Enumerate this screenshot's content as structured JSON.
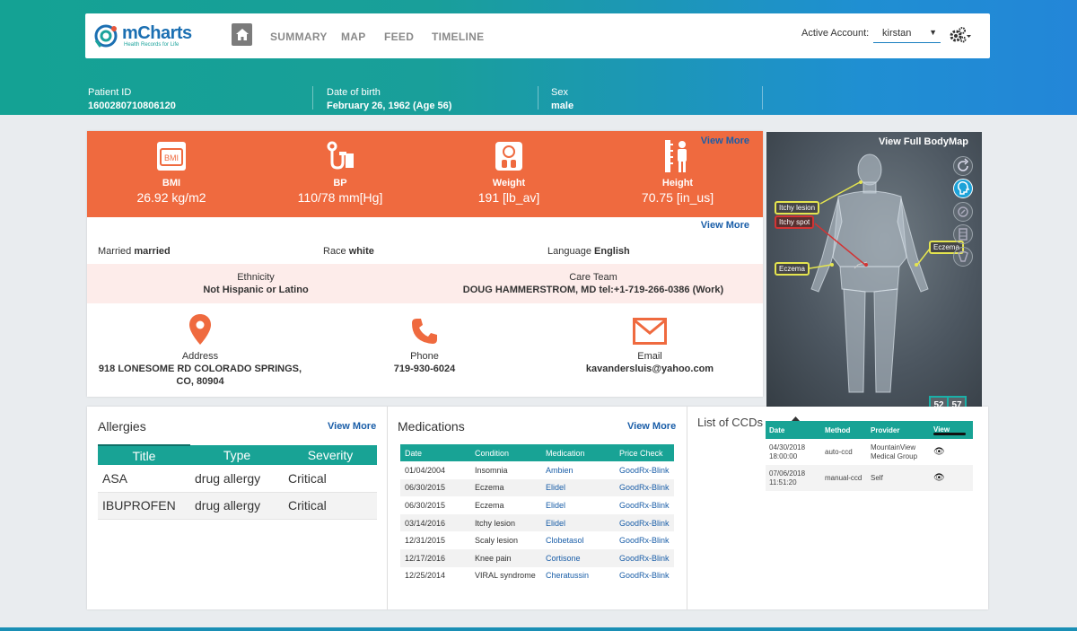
{
  "nav": {
    "logo_name": "mCharts",
    "logo_tagline": "Health Records for Life",
    "links": [
      "SUMMARY",
      "MAP",
      "FEED",
      "TIMELINE"
    ],
    "active_account_label": "Active Account:",
    "active_account_value": "kirstan"
  },
  "patient": {
    "id_label": "Patient ID",
    "id_value": "1600280710806120",
    "dob_label": "Date of birth",
    "dob_value": "February 26, 1962 (Age 56)",
    "sex_label": "Sex",
    "sex_value": "male"
  },
  "vitals": {
    "view_more": "View More",
    "items": [
      {
        "name": "BMI",
        "value": "26.92 kg/m2",
        "icon": "bmi-scale-icon"
      },
      {
        "name": "BP",
        "value": "110/78 mm[Hg]",
        "icon": "stethoscope-icon"
      },
      {
        "name": "Weight",
        "value": "191 [lb_av]",
        "icon": "weight-scale-icon"
      },
      {
        "name": "Height",
        "value": "70.75 [in_us]",
        "icon": "height-ruler-icon"
      }
    ]
  },
  "demographics": {
    "view_more": "View More",
    "married_label": "Married",
    "married_value": "married",
    "race_label": "Race",
    "race_value": "white",
    "language_label": "Language",
    "language_value": "English",
    "ethnicity_label": "Ethnicity",
    "ethnicity_value": "Not Hispanic or Latino",
    "careteam_label": "Care Team",
    "careteam_value": "DOUG HAMMERSTROM, MD tel:+1-719-266-0386 (Work)"
  },
  "contact": {
    "address_label": "Address",
    "address_line1": "918 LONESOME RD COLORADO SPRINGS,",
    "address_line2": "CO, 80904",
    "phone_label": "Phone",
    "phone_value": "719-930-6024",
    "email_label": "Email",
    "email_value": "kavandersluis@yahoo.com"
  },
  "bodymap": {
    "title": "View Full BodyMap",
    "lesions": [
      "Itchy lesion",
      "Itchy spot",
      "Eczema",
      "Eczema"
    ],
    "counters": [
      "52",
      "57"
    ]
  },
  "allergies": {
    "title": "Allergies",
    "view_more": "View More",
    "columns": [
      "Title",
      "Type",
      "Severity"
    ],
    "rows": [
      [
        "ASA",
        "drug allergy",
        "Critical"
      ],
      [
        "IBUPROFEN",
        "drug allergy",
        "Critical"
      ]
    ]
  },
  "medications": {
    "title": "Medications",
    "view_more": "View More",
    "columns": [
      "Date",
      "Condition",
      "Medication",
      "Price Check"
    ],
    "rows": [
      [
        "01/04/2004",
        "Insomnia",
        "Ambien",
        "GoodRx-Blink"
      ],
      [
        "06/30/2015",
        "Eczema",
        "Elidel",
        "GoodRx-Blink"
      ],
      [
        "06/30/2015",
        "Eczema",
        "Elidel",
        "GoodRx-Blink"
      ],
      [
        "03/14/2016",
        "Itchy lesion",
        "Elidel",
        "GoodRx-Blink"
      ],
      [
        "12/31/2015",
        "Scaly lesion",
        "Clobetasol",
        "GoodRx-Blink"
      ],
      [
        "12/17/2016",
        "Knee pain",
        "Cortisone",
        "GoodRx-Blink"
      ],
      [
        "12/25/2014",
        "VIRAL syndrome",
        "Cheratussin",
        "GoodRx-Blink"
      ]
    ]
  },
  "ccds": {
    "title": "List of CCDs",
    "columns": [
      "Date",
      "Method",
      "Provider",
      "View"
    ],
    "rows": [
      {
        "date1": "04/30/2018",
        "date2": "18:00:00",
        "method": "auto-ccd",
        "provider1": "MountainView",
        "provider2": "Medical Group"
      },
      {
        "date1": "07/06/2018",
        "date2": "11:51:20",
        "method": "manual-ccd",
        "provider1": "Self",
        "provider2": ""
      }
    ]
  },
  "colors": {
    "teal": "#18a395",
    "orange": "#ef6a3f",
    "link_blue": "#1a5ea8"
  }
}
